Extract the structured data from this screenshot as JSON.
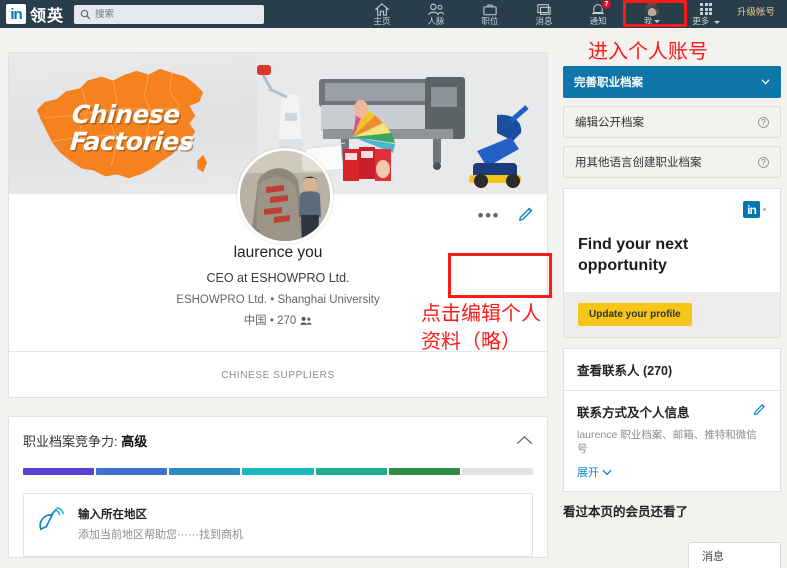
{
  "nav": {
    "brand_cn": "领英",
    "brand_in": "in",
    "search_placeholder": "搜索",
    "items": [
      {
        "label": "主页",
        "icon": "home-icon"
      },
      {
        "label": "人脉",
        "icon": "people-icon"
      },
      {
        "label": "职位",
        "icon": "briefcase-icon"
      },
      {
        "label": "消息",
        "icon": "message-icon"
      },
      {
        "label": "通知",
        "icon": "bell-icon",
        "badge": "7"
      },
      {
        "label": "我",
        "icon": "avatar-icon"
      },
      {
        "label": "更多",
        "icon": "grid-icon"
      }
    ],
    "upgrade": "升级帐号",
    "accent_bg": "#283e4a"
  },
  "annotations": {
    "top": "进入个人账号",
    "edit": "点击编辑个人\n资料（略）",
    "edit_line1": "点击编辑个人",
    "edit_line2": "资料（略）",
    "color": "#ff1a1a"
  },
  "profile": {
    "cover_title_line1": "Chinese",
    "cover_title_line2": "Factories",
    "name": "laurence you",
    "headline": "CEO at ESHOWPRO Ltd.",
    "meta": "ESHOWPRO Ltd.  •  Shanghai University",
    "location": "中国  •  270",
    "company_band": "CHINESE SUPPLIERS",
    "more_dots": "•••"
  },
  "strength": {
    "label": "职业档案竞争力:",
    "level": "高级",
    "segments_total": 7,
    "segments_filled": 6,
    "colors": [
      "#5b3fd4",
      "#3f6fd0",
      "#2a8cc0",
      "#19b8bf",
      "#1fae87",
      "#2e8b40",
      "#dfe3e6"
    ],
    "suggestion_title": "输入所在地区",
    "suggestion_sub": "添加当前地区帮助您······找到商机",
    "suggestion_icon": "radar-dish-icon"
  },
  "sidebar": {
    "primary_button": "完善职业档案",
    "buttons": [
      {
        "label": "编辑公开档案",
        "help": "?"
      },
      {
        "label": "用其他语言创建职业档案",
        "help": "?"
      }
    ],
    "ad": {
      "logo": "in",
      "heading_line1": "Find your next",
      "heading_line2": "opportunity",
      "cta": "Update your profile",
      "cta_color": "#f5c518"
    },
    "connections": "查看联系人 (270)",
    "contact_header": "联系方式及个人信息",
    "contact_sub": "laurence 职业档案、邮箱、推特和微信号",
    "expand": "展开",
    "also_viewed": "看过本页的会员还看了",
    "message_button": "消息"
  }
}
